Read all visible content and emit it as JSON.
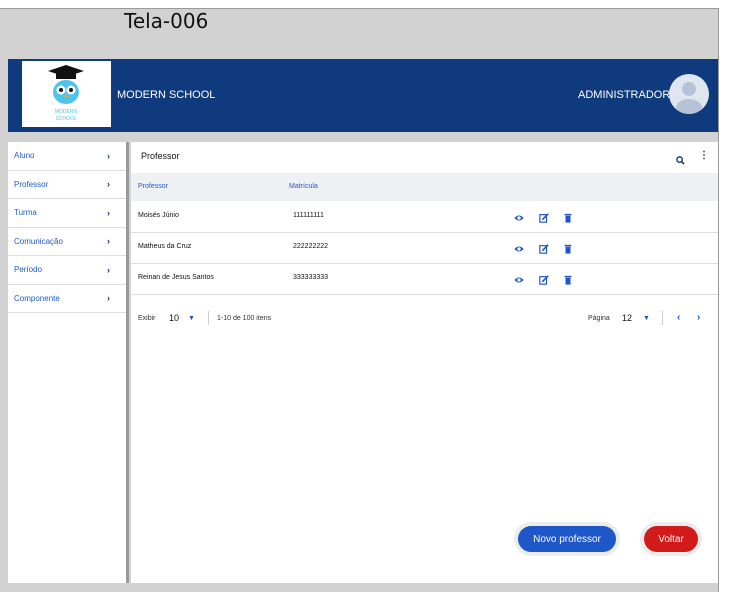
{
  "frame_title": "Tela-006",
  "header": {
    "logo_text_line1": "MODERN",
    "logo_text_line2": "SCHOOL",
    "brand": "MODERN SCHOOL",
    "user_role": "ADMINISTRADOR"
  },
  "sidebar": {
    "items": [
      {
        "label": "Aluno"
      },
      {
        "label": "Professor"
      },
      {
        "label": "Turma"
      },
      {
        "label": "Comunicação"
      },
      {
        "label": "Período"
      },
      {
        "label": "Componente"
      }
    ],
    "chevron": "›"
  },
  "main": {
    "title": "Professor",
    "columns": [
      "Professor",
      "Matrícula"
    ],
    "rows": [
      {
        "name": "Moisés Júnio",
        "id": "111111111"
      },
      {
        "name": "Matheus da Cruz",
        "id": "222222222"
      },
      {
        "name": "Reinan de Jesus Santos",
        "id": "333333333"
      }
    ],
    "row_actions": [
      "view-icon",
      "edit-icon",
      "delete-icon"
    ],
    "footer": {
      "show_label": "Exibir",
      "show_value": "10",
      "range_text": "1-10 de 100 itens",
      "page_label": "Página",
      "page_value": "12",
      "prev": "‹",
      "next": "›"
    }
  },
  "buttons": {
    "new": "Novo professor",
    "back": "Voltar"
  },
  "colors": {
    "header_bg": "#0f3a7d",
    "link_blue": "#1f5bd1",
    "primary_button": "#1e57c8",
    "danger_button": "#d11a1a"
  }
}
